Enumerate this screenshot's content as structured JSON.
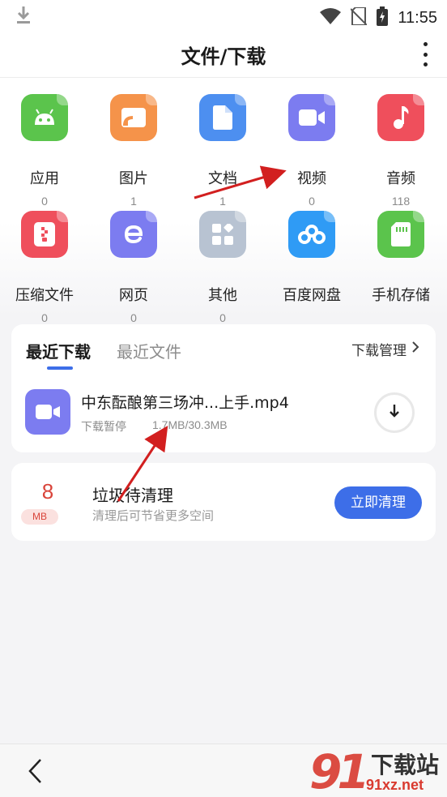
{
  "status_bar": {
    "time": "11:55"
  },
  "header": {
    "title": "文件/下载"
  },
  "categories": [
    {
      "label": "应用",
      "count": "0",
      "icon": "android-icon",
      "color": "#5bc44c"
    },
    {
      "label": "图片",
      "count": "1",
      "icon": "image-icon",
      "color": "#f5934a"
    },
    {
      "label": "文档",
      "count": "1",
      "icon": "document-icon",
      "color": "#4d8ff0"
    },
    {
      "label": "视频",
      "count": "0",
      "icon": "video-icon",
      "color": "#7c7cf0"
    },
    {
      "label": "音频",
      "count": "118",
      "icon": "music-icon",
      "color": "#ef4f5c"
    },
    {
      "label": "压缩文件",
      "count": "0",
      "icon": "zip-icon",
      "color": "#ef4f5c"
    },
    {
      "label": "网页",
      "count": "0",
      "icon": "webpage-icon",
      "color": "#7c7cf0"
    },
    {
      "label": "其他",
      "count": "0",
      "icon": "other-icon",
      "color": "#b8c3d2"
    },
    {
      "label": "百度网盘",
      "count": "",
      "icon": "baidu-netdisk-icon",
      "color": "#2f9bf5"
    },
    {
      "label": "手机存储",
      "count": "",
      "icon": "sd-card-icon",
      "color": "#5bc44c"
    }
  ],
  "recent": {
    "tab_downloads": "最近下载",
    "tab_files": "最近文件",
    "manage_label": "下载管理",
    "file": {
      "name": "中东酝酿第三场冲...上手.mp4",
      "status": "下载暂停",
      "size": "1.7MB/30.3MB"
    }
  },
  "cleanup": {
    "amount": "8",
    "unit": "MB",
    "title": "垃圾待清理",
    "subtitle": "清理后可节省更多空间",
    "button": "立即清理"
  },
  "watermark": {
    "digits": "91",
    "name": "下载站",
    "url": "91xz.net"
  },
  "colors": {
    "accent": "#3d6ee8",
    "junk": "#d9443a",
    "annotation_arrow": "#d21f1f"
  }
}
